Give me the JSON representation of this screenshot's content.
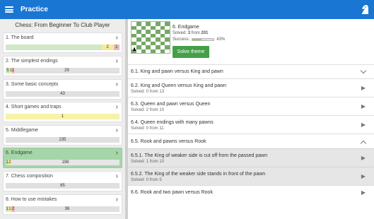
{
  "appbar": {
    "title": "Practice"
  },
  "course": {
    "title": "Chess: From Beginner To Club Player",
    "chapters": [
      {
        "label": "1. The board",
        "segments": [
          {
            "text": "",
            "color": "#cfe8c8",
            "weight": 128
          },
          {
            "text": "2",
            "color": "#f5ea9a",
            "weight": 16
          },
          {
            "text": "1",
            "color": "#e8b8b8",
            "weight": 8
          }
        ]
      },
      {
        "label": "2. The simplest endings",
        "segments": [
          {
            "text": "5",
            "color": "#cfe8c8",
            "weight": 6
          },
          {
            "text": "1",
            "color": "#f5ea9a",
            "weight": 3
          },
          {
            "text": "1",
            "color": "#e8b8b8",
            "weight": 3
          },
          {
            "text": "29",
            "color": "#e0e0e0",
            "weight": 150
          }
        ]
      },
      {
        "label": "3. Some basic concepts",
        "segments": [
          {
            "text": "43",
            "color": "#e0e0e0",
            "weight": 162
          }
        ]
      },
      {
        "label": "4. Short games and traps",
        "segments": [
          {
            "text": "1",
            "color": "#f6f2a8",
            "weight": 162
          }
        ]
      },
      {
        "label": "5. Middlegame",
        "segments": [
          {
            "text": "235",
            "color": "#e0e0e0",
            "weight": 162
          }
        ]
      },
      {
        "label": "6. Endgame",
        "segments": [
          {
            "text": "1",
            "color": "#c9e4c0",
            "weight": 4
          },
          {
            "text": "2",
            "color": "#f5ea9a",
            "weight": 4
          },
          {
            "text": "198",
            "color": "#e6e6e6",
            "weight": 154
          }
        ]
      },
      {
        "label": "7. Chess composition",
        "segments": [
          {
            "text": "85",
            "color": "#e0e0e0",
            "weight": 162
          }
        ]
      },
      {
        "label": "8. How to use mistakes",
        "segments": [
          {
            "text": "1",
            "color": "#cfe8c8",
            "weight": 4
          },
          {
            "text": "1",
            "color": "#f5ea9a",
            "weight": 4
          },
          {
            "text": "2",
            "color": "#e8b8b8",
            "weight": 5
          },
          {
            "text": "36",
            "color": "#e0e0e0",
            "weight": 149
          }
        ]
      }
    ]
  },
  "detail": {
    "title": "6. Endgame",
    "solved_prefix": "Solved: ",
    "solved_count": "3",
    "solved_mid": " from ",
    "solved_total": "201",
    "success_label": "Success:",
    "success_value": "43%",
    "success_fraction": 0.43,
    "solve_button": "Solve theme",
    "board_piece": "♟",
    "rows": [
      {
        "title": "6.1. King and pawn versus King and pawn",
        "sub": "",
        "icon": "chevron-down-icon",
        "type": "section"
      },
      {
        "title": "6.2. King and Queen versus King and pawn",
        "sub": "Solved: 0 from 13",
        "icon": "play-icon",
        "type": "item"
      },
      {
        "title": "6.3. Queen and pawn versus Queen",
        "sub": "Solved: 2 from 10",
        "icon": "play-icon",
        "type": "item"
      },
      {
        "title": "6.4. Queen endings with many pawns",
        "sub": "Solved: 0 from 11",
        "icon": "play-icon",
        "type": "item"
      },
      {
        "title": "6.5. Rook and pawns versus Rook",
        "sub": "",
        "icon": "chevron-up-icon",
        "type": "section"
      },
      {
        "title": "6.5.1. The King of weaker side is cut off from the passed pawn",
        "sub": "Solved: 1 from 10",
        "icon": "play-icon",
        "type": "sub"
      },
      {
        "title": "6.5.2. The King of the weaker side stands in front of the pawn",
        "sub": "Solved: 0 from 5",
        "icon": "play-icon",
        "type": "sub"
      },
      {
        "title": "6.6. Rook and two pawn versus Rook",
        "sub": "",
        "icon": "play-icon",
        "type": "item"
      }
    ]
  },
  "colors": {
    "appbar": "#1976d2",
    "active_card": "#a5d6a7",
    "button": "#43a047",
    "board_dark": "#76a866",
    "board_light": "#ffffff"
  }
}
